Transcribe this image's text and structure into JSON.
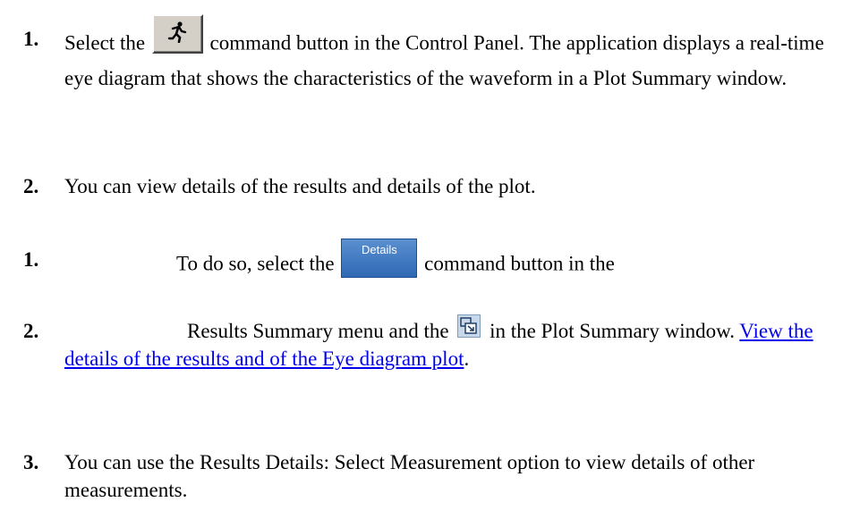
{
  "steps": [
    {
      "number": "1.",
      "before": "Select the",
      "after": "command button in the Control Panel. The application displays a real-time eye diagram that shows the characteristics of the waveform in a Plot Summary window."
    },
    {
      "number": "2.",
      "text": "You can view details of the results and details of the plot."
    },
    {
      "number": "1.",
      "before": "To do so, select the",
      "after": "command button in the"
    },
    {
      "number": "2.",
      "before": "Results Summary menu and the",
      "after": "in the Plot Summary window.",
      "link_text": "View the details of the results and of the Eye diagram plot",
      "end": "."
    },
    {
      "number": "3.",
      "text": "You can use the Results Details: Select Measurement option to view details of other measurements."
    }
  ],
  "buttons": {
    "run_icon": "running-man-icon",
    "details_label": "Details",
    "plot_icon": "expand-plot-icon"
  },
  "colors": {
    "link": "#0000ee",
    "details_button": "#3a74c0"
  }
}
